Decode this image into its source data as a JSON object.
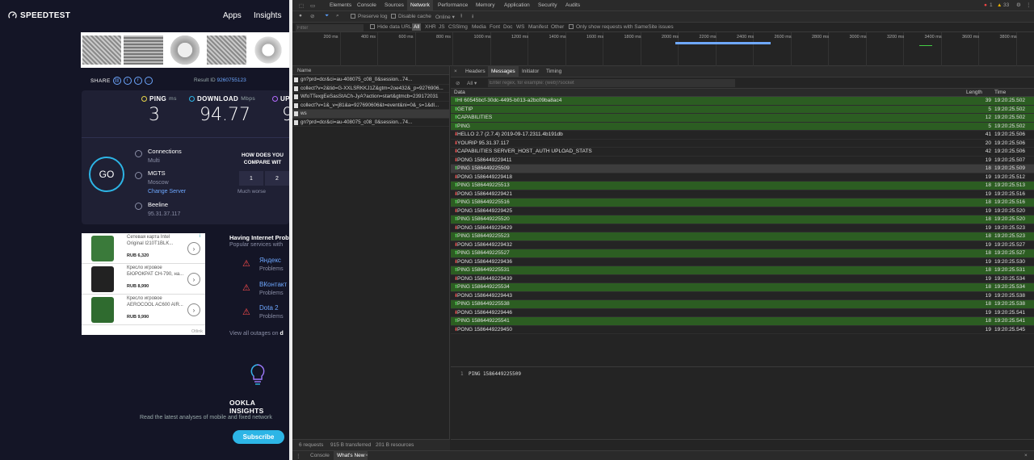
{
  "speedtest": {
    "logo": "SPEEDTEST",
    "nav": [
      "Apps",
      "Insights"
    ],
    "share_label": "SHARE",
    "result_label": "Result ID",
    "result_id": "9260755123",
    "ping_label": "PING",
    "ping_unit": "ms",
    "ping_value": "3",
    "download_label": "DOWNLOAD",
    "download_unit": "Mbps",
    "download_value": "94.77",
    "upload_label": "UP",
    "upload_value_partial": "9",
    "go_label": "GO",
    "connections_label": "Connections",
    "connections_value": "Multi",
    "server_name": "MGTS",
    "server_city": "Moscow",
    "change_server": "Change Server",
    "isp_name": "Beeline",
    "isp_ip": "95.31.37.117",
    "compare_q": "HOW DOES YOU COMPARE WIT",
    "compare_buttons": [
      "1",
      "2"
    ],
    "much_worse": "Much worse",
    "outages_title": "Having Internet Probl",
    "outages_sub": "Popular services with",
    "outages": [
      {
        "name": "Яндекс",
        "status": "Problems"
      },
      {
        "name": "ВКонтакт",
        "status": "Problems"
      },
      {
        "name": "Dota 2",
        "status": "Problems"
      }
    ],
    "view_all": "View all outages on",
    "view_all_suffix": "d",
    "ookla_insights": "OOKLA INSIGHTS",
    "ookla_desc": "Read the latest analyses of mobile and fixed network",
    "subscribe": "Subscribe"
  },
  "ads": {
    "badge": "i",
    "items": [
      {
        "title": "Сетевая карта Intel Original I210T1BLK...",
        "price": "RUB 6,320"
      },
      {
        "title": "Кресло игровое БЮРОКРАТ CH-790, на...",
        "price": "RUB 8,990"
      },
      {
        "title": "Кресло игровое AEROCOOL AC600 AIR...",
        "price": "RUB 9,990"
      }
    ],
    "footer": "Otlink"
  },
  "devtools": {
    "tabs": [
      "Elements",
      "Console",
      "Sources",
      "Network",
      "Performance",
      "Memory",
      "Application",
      "Security",
      "Audits"
    ],
    "active_tab": "Network",
    "errors": "1",
    "warnings": "33",
    "preserve_log": "Preserve log",
    "disable_cache": "Disable cache",
    "online": "Online",
    "filter_placeholder": "Filter",
    "hide_data_urls": "Hide data URLs",
    "all_chip": "All",
    "types": [
      "XHR",
      "JS",
      "CSS",
      "Img",
      "Media",
      "Font",
      "Doc",
      "WS",
      "Manifest",
      "Other"
    ],
    "samesite": "Only show requests with SameSite issues",
    "ticks": [
      "200 ms",
      "400 ms",
      "600 ms",
      "800 ms",
      "1000 ms",
      "1200 ms",
      "1400 ms",
      "1600 ms",
      "1800 ms",
      "2000 ms",
      "2200 ms",
      "2400 ms",
      "2600 ms",
      "2800 ms",
      "3000 ms",
      "3200 ms",
      "3400 ms",
      "3600 ms",
      "3800 ms"
    ],
    "name_header": "Name",
    "requests": [
      "gn?prd=dcr&ci=au-408075_c08_0&session...74...",
      "collect?v=2&tid=G-XXLSRKKJ1Z&gtm=2oe432&_p=9276906...",
      "WfoTTexgEeSasStACh-JyA?action=start&gtmcb=239172031",
      "collect?v=1&_v=j81&a=927690606&t=event&ni=0&_s=1&dl...",
      "ws",
      "gn?prd=dcr&ci=au-408075_c08_0&session...74..."
    ],
    "detail_tabs": [
      "Headers",
      "Messages",
      "Initiator",
      "Timing"
    ],
    "detail_active": "Messages",
    "msg_filter_all": "All",
    "msg_filter_placeholder": "Enter regex, for example: (web)?socket",
    "col_data": "Data",
    "col_length": "Length",
    "col_time": "Time",
    "messages": [
      {
        "dir": "up",
        "data": "HI 60545bcf-30dc-4495-b013-a2bc09ba8ac4",
        "len": "39",
        "time": "19:20:25.502"
      },
      {
        "dir": "up",
        "data": "GETIP",
        "len": "5",
        "time": "19:20:25.502"
      },
      {
        "dir": "up",
        "data": "CAPABILITIES",
        "len": "12",
        "time": "19:20:25.502"
      },
      {
        "dir": "up",
        "data": "PING",
        "len": "5",
        "time": "19:20:25.502"
      },
      {
        "dir": "down",
        "data": "HELLO 2.7 (2.7.4) 2019-09-17.2311.4b191db",
        "len": "41",
        "time": "19:20:25.506"
      },
      {
        "dir": "down",
        "data": "YOURIP 95.31.37.117",
        "len": "20",
        "time": "19:20:25.506"
      },
      {
        "dir": "down",
        "data": "CAPABILITIES SERVER_HOST_AUTH UPLOAD_STATS",
        "len": "42",
        "time": "19:20:25.506"
      },
      {
        "dir": "down",
        "data": "PONG 1586449229411",
        "len": "19",
        "time": "19:20:25.507"
      },
      {
        "dir": "up",
        "data": "PING 1586449225509",
        "len": "18",
        "time": "19:20:25.509"
      },
      {
        "dir": "down",
        "data": "PONG 1586449229418",
        "len": "19",
        "time": "19:20:25.512"
      },
      {
        "dir": "up",
        "data": "PING 1586449225513",
        "len": "18",
        "time": "19:20:25.513"
      },
      {
        "dir": "down",
        "data": "PONG 1586449229421",
        "len": "19",
        "time": "19:20:25.516"
      },
      {
        "dir": "up",
        "data": "PING 1586449225516",
        "len": "18",
        "time": "19:20:25.516"
      },
      {
        "dir": "down",
        "data": "PONG 1586449229425",
        "len": "19",
        "time": "19:20:25.520"
      },
      {
        "dir": "up",
        "data": "PING 1586449225520",
        "len": "18",
        "time": "19:20:25.520"
      },
      {
        "dir": "down",
        "data": "PONG 1586449229429",
        "len": "19",
        "time": "19:20:25.523"
      },
      {
        "dir": "up",
        "data": "PING 1586449225523",
        "len": "18",
        "time": "19:20:25.523"
      },
      {
        "dir": "down",
        "data": "PONG 1586449229432",
        "len": "19",
        "time": "19:20:25.527"
      },
      {
        "dir": "up",
        "data": "PING 1586449225527",
        "len": "18",
        "time": "19:20:25.527"
      },
      {
        "dir": "down",
        "data": "PONG 1586449229436",
        "len": "19",
        "time": "19:20:25.530"
      },
      {
        "dir": "up",
        "data": "PING 1586449225531",
        "len": "18",
        "time": "19:20:25.531"
      },
      {
        "dir": "down",
        "data": "PONG 1586449229439",
        "len": "19",
        "time": "19:20:25.534"
      },
      {
        "dir": "up",
        "data": "PING 1586449225534",
        "len": "18",
        "time": "19:20:25.534"
      },
      {
        "dir": "down",
        "data": "PONG 1586449229443",
        "len": "19",
        "time": "19:20:25.538"
      },
      {
        "dir": "up",
        "data": "PING 1586449225538",
        "len": "18",
        "time": "19:20:25.538"
      },
      {
        "dir": "down",
        "data": "PONG 1586449229446",
        "len": "19",
        "time": "19:20:25.541"
      },
      {
        "dir": "up",
        "data": "PING 1586449225541",
        "len": "18",
        "time": "19:20:25.541"
      },
      {
        "dir": "down",
        "data": "PONG 1586449229450",
        "len": "19",
        "time": "19:20:25.545"
      }
    ],
    "selected_index": 8,
    "preview_line_no": "1",
    "preview_text": "PING 1586449225509",
    "status_requests": "6 requests",
    "status_transferred": "915 B transferred",
    "status_resources": "201 B resources",
    "drawer_tabs": [
      "Console",
      "What's New"
    ],
    "drawer_active": "What's New",
    "colors": {
      "sent_row": "#2c5d22",
      "accent": "#2db5e6",
      "link": "#6da7ff"
    }
  }
}
